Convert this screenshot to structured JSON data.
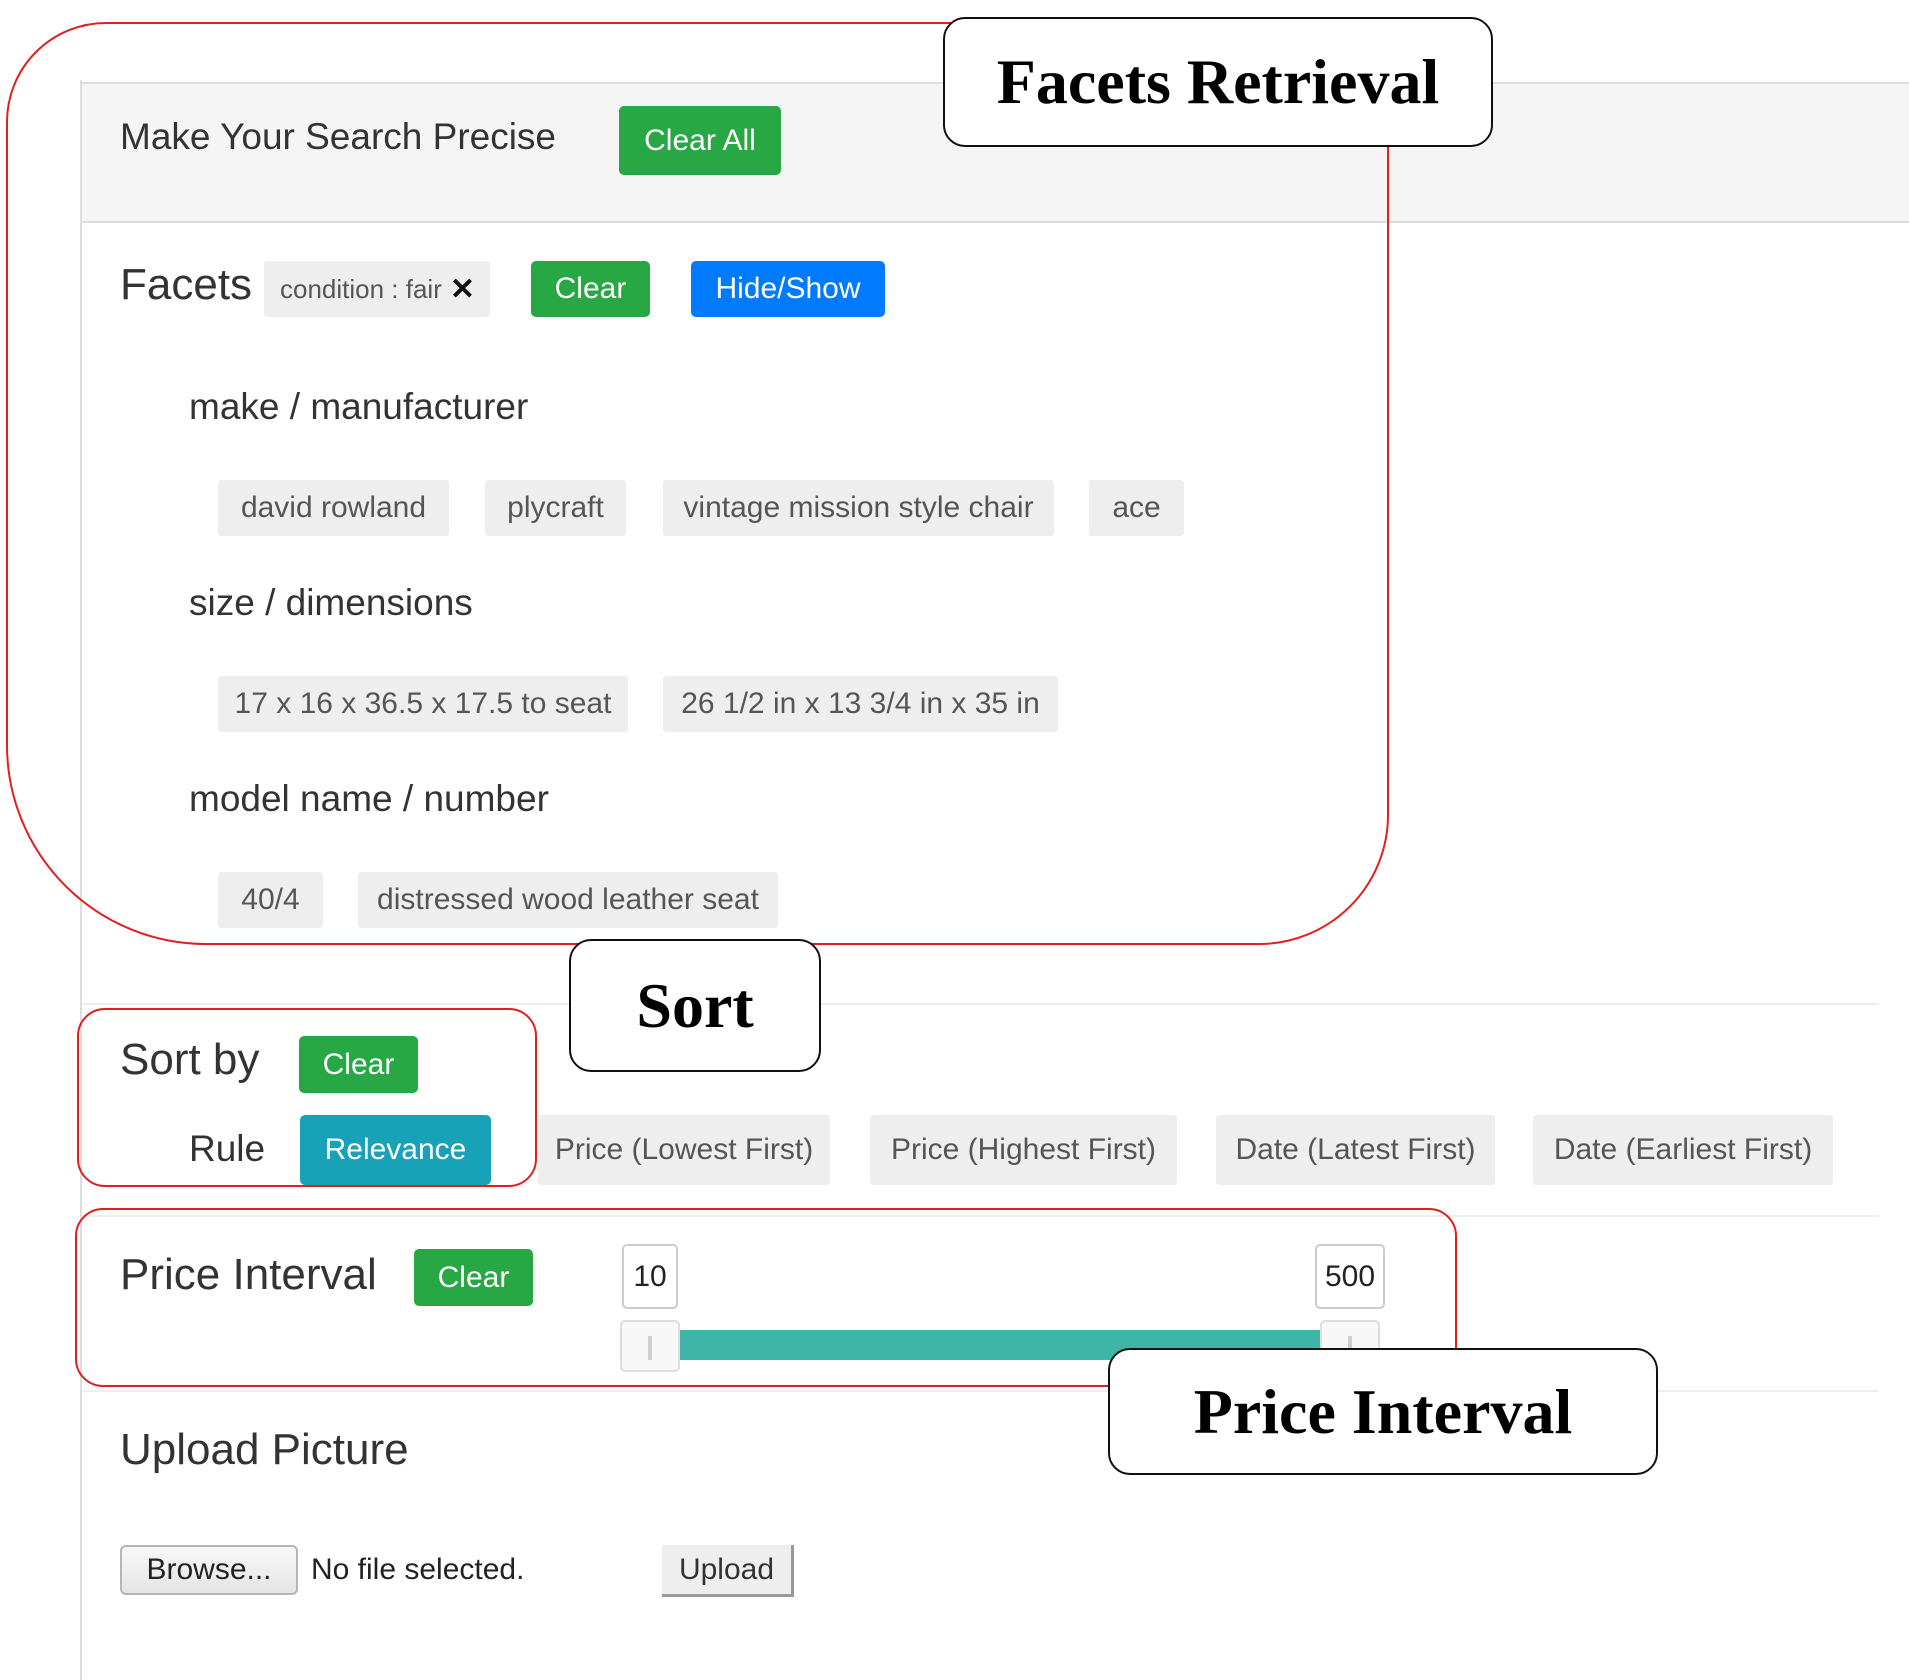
{
  "header": {
    "title": "Make Your Search Precise",
    "clear_all_label": "Clear All"
  },
  "facets": {
    "title": "Facets",
    "active_filter": "condition : fair",
    "remove_glyph": "✕",
    "clear_label": "Clear",
    "hide_show_label": "Hide/Show",
    "groups": [
      {
        "label": "make / manufacturer",
        "options": [
          "david rowland",
          "plycraft",
          "vintage mission style chair",
          "ace"
        ]
      },
      {
        "label": "size / dimensions",
        "options": [
          "17 x 16 x 36.5 x 17.5 to seat",
          "26 1/2 in x 13 3/4 in x 35 in"
        ]
      },
      {
        "label": "model name / number",
        "options": [
          "40/4",
          "distressed wood leather seat"
        ]
      }
    ]
  },
  "sort": {
    "title": "Sort by",
    "clear_label": "Clear",
    "rule_label": "Rule",
    "options": [
      "Relevance",
      "Price (Lowest First)",
      "Price (Highest First)",
      "Date (Latest First)",
      "Date (Earliest First)"
    ],
    "selected": "Relevance"
  },
  "price": {
    "title": "Price Interval",
    "clear_label": "Clear",
    "min": "10",
    "max": "500"
  },
  "upload": {
    "title": "Upload Picture",
    "browse_label": "Browse...",
    "no_file_text": "No file selected.",
    "upload_label": "Upload"
  },
  "annotations": {
    "facets_retrieval": "Facets Retrieval",
    "sort": "Sort",
    "price_interval": "Price Interval"
  },
  "colors": {
    "green": "#28a745",
    "blue": "#007bff",
    "teal": "#17a2b8",
    "slider": "#3fb5a8",
    "annotation_red": "#e02020"
  }
}
